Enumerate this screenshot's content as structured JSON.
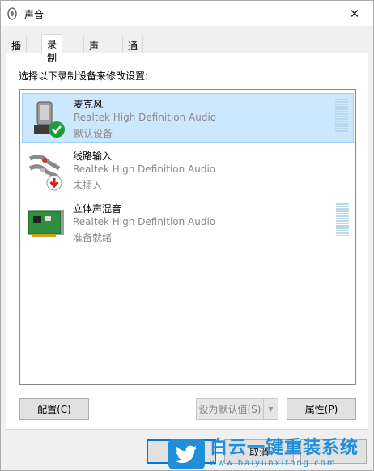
{
  "window": {
    "title": "声音",
    "close_glyph": "✕"
  },
  "tabs": [
    {
      "label": "播放",
      "active": false
    },
    {
      "label": "录制",
      "active": true
    },
    {
      "label": "声音",
      "active": false
    },
    {
      "label": "通信",
      "active": false
    }
  ],
  "panel": {
    "instruction": "选择以下录制设备来修改设置:",
    "devices": [
      {
        "name": "麦克风",
        "driver": "Realtek High Definition Audio",
        "status": "默认设备",
        "icon": "microphone-icon",
        "badge": "default-checkmark-icon",
        "selected": true
      },
      {
        "name": "线路输入",
        "driver": "Realtek High Definition Audio",
        "status": "未插入",
        "icon": "line-in-cable-icon",
        "badge": "unplugged-arrow-icon",
        "selected": false
      },
      {
        "name": "立体声混音",
        "driver": "Realtek High Definition Audio",
        "status": "准备就绪",
        "icon": "sound-card-icon",
        "badge": "",
        "selected": false
      }
    ],
    "buttons": {
      "configure": "配置(C)",
      "set_default": "设为默认值(S)",
      "properties": "属性(P)"
    }
  },
  "footer": {
    "ok": "",
    "cancel": "取消",
    "apply": ""
  },
  "watermark": {
    "brand": "白云一键重装系统",
    "url": "www.baiyunxitong.com"
  },
  "colors": {
    "selection_bg": "#cce8ff",
    "selection_border": "#99d1ff",
    "accent": "#0078d7",
    "meter": "#b9d9e8",
    "check_green": "#1a9c3a",
    "watermark_blue": "#1e8fd8"
  }
}
